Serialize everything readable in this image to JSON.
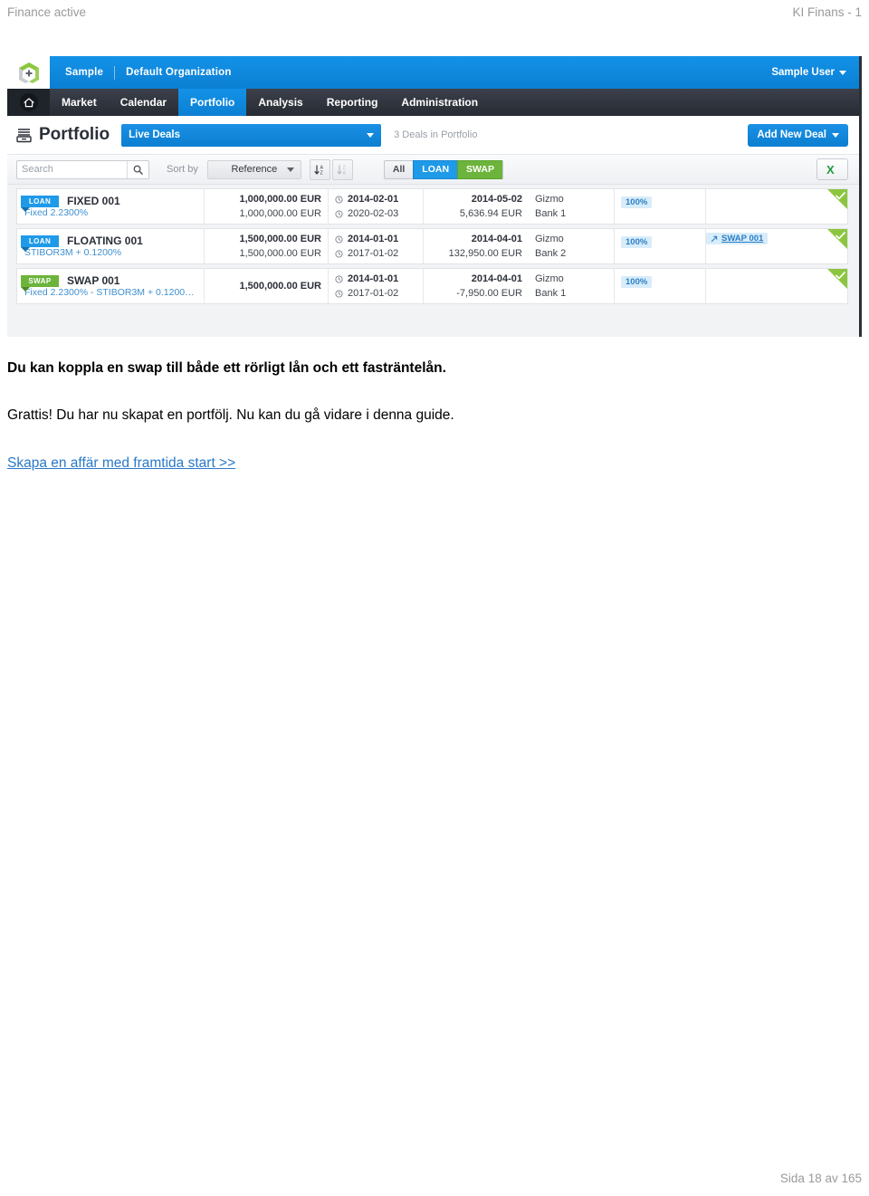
{
  "page_header": {
    "left": "Finance active",
    "right": "KI Finans - 1"
  },
  "app": {
    "org_bar": {
      "logo_icon": "ki-finans-logo-icon",
      "workspace": "Sample",
      "organization": "Default Organization",
      "user": "Sample User",
      "user_caret_icon": "caret-down-icon"
    },
    "nav": {
      "home_icon": "home-icon",
      "items": [
        {
          "label": "Market",
          "active": false
        },
        {
          "label": "Calendar",
          "active": false
        },
        {
          "label": "Portfolio",
          "active": true
        },
        {
          "label": "Analysis",
          "active": false
        },
        {
          "label": "Reporting",
          "active": false
        },
        {
          "label": "Administration",
          "active": false
        }
      ]
    },
    "title_bar": {
      "icon": "portfolio-icon",
      "title": "Portfolio",
      "deal_filter_value": "Live Deals",
      "deals_count": "3 Deals in Portfolio",
      "add_new_deal": "Add New Deal"
    },
    "toolbar": {
      "search_placeholder": "Search",
      "search_value": "",
      "search_icon": "search-icon",
      "sort_by_label": "Sort by",
      "sort_by_value": "Reference",
      "sort_asc_icon": "sort-ascending-icon",
      "sort_desc_icon": "sort-descending-icon",
      "filters": [
        {
          "label": "All",
          "state": "inactive"
        },
        {
          "label": "LOAN",
          "state": "loan"
        },
        {
          "label": "SWAP",
          "state": "swap"
        }
      ],
      "export_icon": "excel-export-icon"
    },
    "deals": [
      {
        "type": "LOAN",
        "reference": "FIXED 001",
        "rate": "Fixed 2.2300%",
        "amount_top": "1,000,000.00 EUR",
        "amount_bottom": "1,000,000.00 EUR",
        "date_top": "2014-02-01",
        "date_bottom": "2020-02-03",
        "flow_date": "2014-05-02",
        "flow_amount": "5,636.94 EUR",
        "party_top": "Gizmo",
        "party_bottom": "Bank 1",
        "percent": "100%",
        "linked_deal": "",
        "status_icon": "check-corner-icon"
      },
      {
        "type": "LOAN",
        "reference": "FLOATING 001",
        "rate": "STIBOR3M + 0.1200%",
        "amount_top": "1,500,000.00 EUR",
        "amount_bottom": "1,500,000.00 EUR",
        "date_top": "2014-01-01",
        "date_bottom": "2017-01-02",
        "flow_date": "2014-04-01",
        "flow_amount": "132,950.00 EUR",
        "party_top": "Gizmo",
        "party_bottom": "Bank 2",
        "percent": "100%",
        "linked_deal": "SWAP 001",
        "status_icon": "check-corner-icon"
      },
      {
        "type": "SWAP",
        "reference": "SWAP 001",
        "rate": "Fixed 2.2300% - STIBOR3M + 0.1200…",
        "amount_top": "1,500,000.00 EUR",
        "amount_bottom": "",
        "date_top": "2014-01-01",
        "date_bottom": "2017-01-02",
        "flow_date": "2014-04-01",
        "flow_amount": "-7,950.00 EUR",
        "party_top": "Gizmo",
        "party_bottom": "Bank 1",
        "percent": "100%",
        "linked_deal": "",
        "status_icon": "check-corner-icon"
      }
    ]
  },
  "body": {
    "paragraph_1": "Du kan koppla en swap till både ett rörligt lån och ett fasträntelån.",
    "paragraph_2": "Grattis! Du har nu skapat en portfölj. Nu kan du gå vidare i denna guide.",
    "link": "Skapa en affär med framtida start >>"
  },
  "page_footer": {
    "text": "Sida 18 av 165"
  },
  "colors": {
    "brand_blue": "#0d86dd",
    "brand_green": "#6cb43b",
    "nav_dark": "#2f333c",
    "link_blue": "#2a79c8",
    "status_green": "#8cc63f"
  }
}
